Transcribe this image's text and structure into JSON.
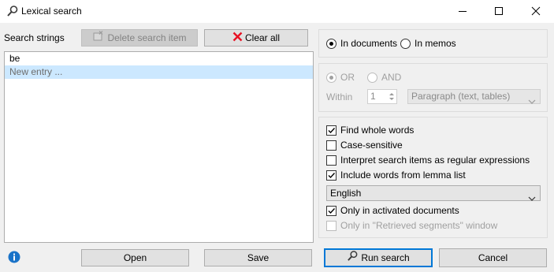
{
  "window": {
    "title": "Lexical search",
    "icon": "magnifier-icon",
    "controls": [
      "minimize",
      "maximize",
      "close"
    ]
  },
  "left_panel": {
    "search_strings_label": "Search strings",
    "delete_button": {
      "label": "Delete search item",
      "enabled": false
    },
    "clear_all_button": {
      "label": "Clear all"
    },
    "entries": [
      "be",
      "New entry ..."
    ],
    "selected_index": 1,
    "open_button": "Open",
    "save_button": "Save"
  },
  "scope": {
    "in_documents": "In documents",
    "in_memos": "In memos",
    "selected": "in_documents"
  },
  "operator": {
    "or_label": "OR",
    "and_label": "AND",
    "within_label": "Within",
    "within_value": "1",
    "within_unit": "Paragraph (text, tables)",
    "enabled": false
  },
  "options": {
    "find_whole_words": {
      "label": "Find whole words",
      "checked": true
    },
    "case_sensitive": {
      "label": "Case-sensitive",
      "checked": false
    },
    "regex": {
      "label": "Interpret search items as regular expressions",
      "checked": false
    },
    "lemma": {
      "label": "Include words from lemma list",
      "checked": true
    },
    "language": "English",
    "activated_only": {
      "label": "Only in activated documents",
      "checked": true
    },
    "retrieved_only": {
      "label": "Only in \"Retrieved segments\" window",
      "checked": false,
      "enabled": false
    }
  },
  "footer": {
    "info_icon": "info-icon",
    "run_search": "Run search",
    "cancel": "Cancel"
  },
  "colors": {
    "background": "#f0f0f0",
    "selected_row": "#cce8ff",
    "default_button_border": "#0078d7",
    "clear_icon": "#e81123",
    "info_icon": "#1a73c8"
  }
}
